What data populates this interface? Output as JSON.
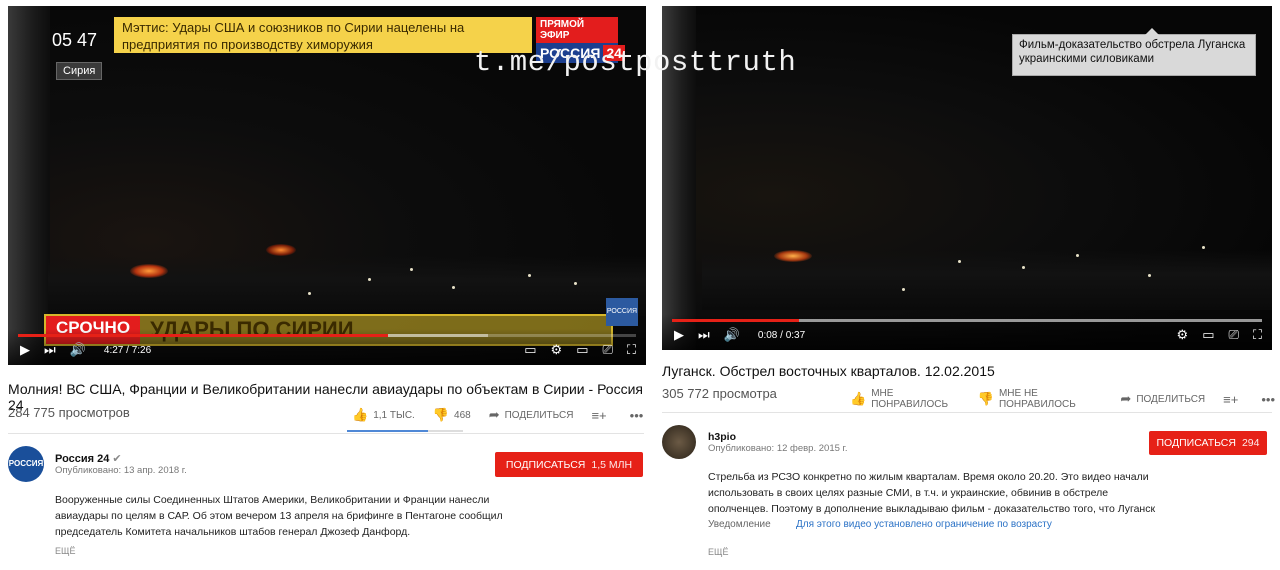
{
  "watermark": "t.me/postposttruth",
  "left": {
    "video": {
      "clock": "05 47",
      "location_tag": "Сирия",
      "headline_ticker": "Мэттис: Удары США и союзников по Сирии нацелены на предприятия по производству химоружия",
      "live_label": "ПРЯМОЙ ЭФИР",
      "channel_logo_text": "РОССИЯ",
      "channel_logo_num": "24",
      "urgent_label": "СРОЧНО",
      "urgent_text": "УДАРЫ ПО СИРИИ",
      "corner_logo": "РОССИЯ",
      "time_current": "4:27",
      "time_sep": " / ",
      "time_total": "7:26",
      "progress_fraction": 0.598,
      "buffered_fraction": 0.76
    },
    "title": "Молния! ВС США, Франции и Великобритании нанесли авиаудары по объектам в Сирии - Россия 24",
    "views": "284 775 просмотров",
    "likes": "1,1 ТЫС.",
    "dislikes": "468",
    "share": "ПОДЕЛИТЬСЯ",
    "like_ratio": 0.7,
    "channel": {
      "name": "Россия 24",
      "published": "Опубликовано: 13 апр. 2018 г.",
      "subscribe": "ПОДПИСАТЬСЯ",
      "sub_count": "1,5 МЛН",
      "avatar_text": "РОССИЯ"
    },
    "description": [
      "Вооруженные силы Соединенных Штатов Америки, Великобритании и Франции нанесли",
      "авиаудары по целям в САР. Об этом вечером 13 апреля на брифинге в Пентагоне сообщил",
      "председатель Комитета начальников штабов генерал Джозеф Данфорд."
    ],
    "more": "ЕЩЁ"
  },
  "right": {
    "video": {
      "annotation": "Фильм-доказательство обстрела Луганска украинскими силовиками",
      "time_current": "0:08",
      "time_sep": " / ",
      "time_total": "0:37",
      "progress_fraction": 0.216,
      "buffered_fraction": 1.0
    },
    "title": "Луганск. Обстрел восточных кварталов. 12.02.2015",
    "views": "305 772 просмотра",
    "likes": "МНЕ ПОНРАВИЛОСЬ",
    "dislikes": "МНЕ НЕ ПОНРАВИЛОСЬ",
    "share": "ПОДЕЛИТЬСЯ",
    "channel": {
      "name": "h3pio",
      "published": "Опубликовано: 12 февр. 2015 г.",
      "subscribe": "ПОДПИСАТЬСЯ",
      "sub_count": "294"
    },
    "description": [
      "Стрельба из РСЗО конкретно по жилым кварталам. Время около 20.20. Это видео начали",
      "использовать в своих целях разные СМИ, в т.ч. и украинские, обвинив в обстреле",
      "ополченцев. Поэтому в дополнение выкладываю фильм - доказательство того, что Луганск"
    ],
    "notice_label": "Уведомление",
    "notice_value": "Для этого видео установлено ограничение по возрасту",
    "more": "ЕЩЁ"
  }
}
